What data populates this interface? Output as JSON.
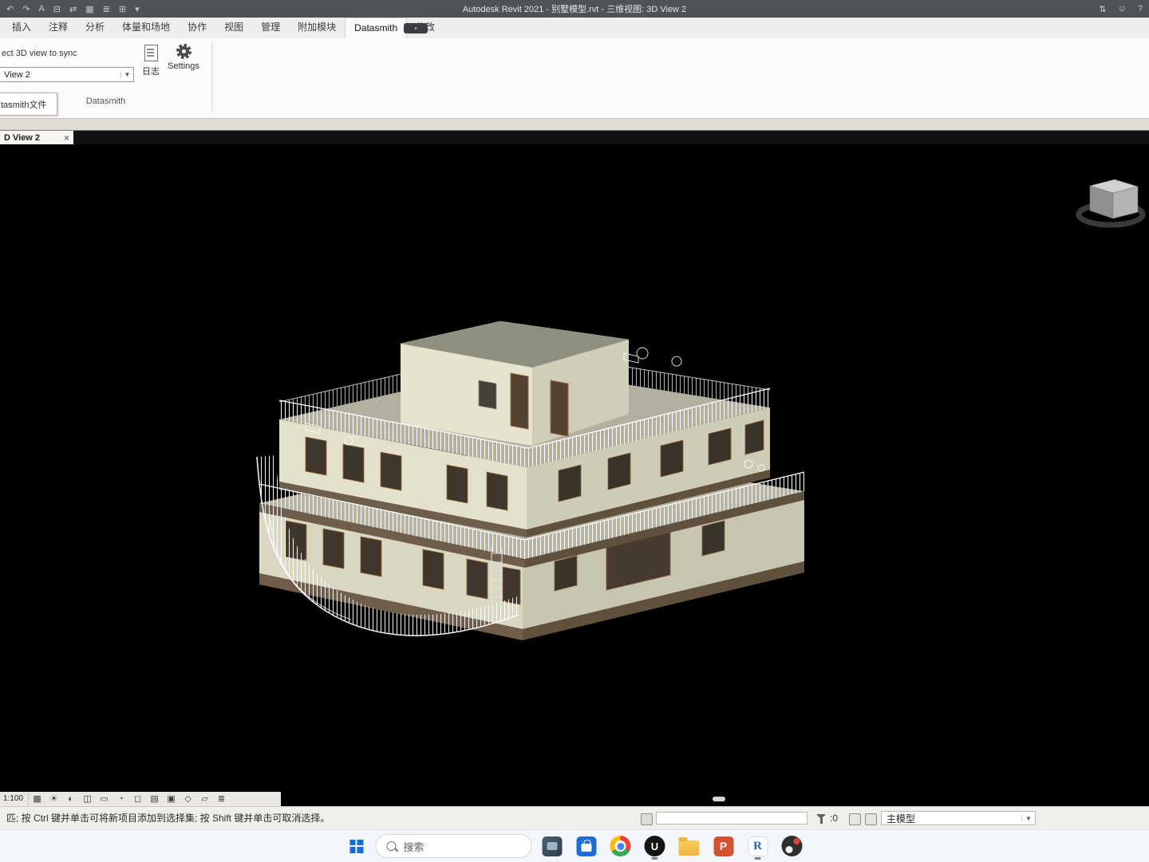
{
  "title_bar": {
    "title": "Autodesk Revit 2021 - 别墅模型.rvt - 三维视图: 3D View 2",
    "qat_icons": [
      {
        "name": "undo-icon",
        "glyph": "↶"
      },
      {
        "name": "redo-icon",
        "glyph": "↷"
      },
      {
        "name": "text-icon",
        "glyph": "A"
      },
      {
        "name": "print-icon",
        "glyph": "⊟"
      },
      {
        "name": "measure-icon",
        "glyph": "⇄"
      },
      {
        "name": "grid-icon",
        "glyph": "▦"
      },
      {
        "name": "list-icon",
        "glyph": "≣"
      },
      {
        "name": "tile-windows-icon",
        "glyph": "⊞"
      },
      {
        "name": "qat-dropdown-icon",
        "glyph": "▾"
      }
    ],
    "right_icons": [
      {
        "name": "collaborate-icon",
        "glyph": "⇅"
      },
      {
        "name": "user-icon",
        "glyph": "☺"
      },
      {
        "name": "help-icon",
        "glyph": "?"
      }
    ]
  },
  "ribbon": {
    "tabs": [
      {
        "label": "插入"
      },
      {
        "label": "注释"
      },
      {
        "label": "分析"
      },
      {
        "label": "体量和场地"
      },
      {
        "label": "协作"
      },
      {
        "label": "视图"
      },
      {
        "label": "管理"
      },
      {
        "label": "附加模块"
      },
      {
        "label": "Datasmith",
        "active": true
      },
      {
        "label": "修改"
      }
    ],
    "active_tab": "Datasmith",
    "extra_button_glyph": "▪"
  },
  "datasmith": {
    "sync_label": "ect 3D view to sync",
    "view_value": "View 2",
    "arrow_glyph": "▼",
    "log_label": "日志",
    "settings_label": "Settings",
    "panel_title": "Datasmith",
    "file_panel_label": "tasmith文件"
  },
  "view_tab": {
    "label": "D View 2",
    "close_glyph": "×"
  },
  "viewbar": {
    "scale_label": "1:100",
    "icons": [
      {
        "name": "visual-style-icon",
        "glyph": "▦"
      },
      {
        "name": "sun-path-icon",
        "glyph": "☀"
      },
      {
        "name": "shadows-icon",
        "glyph": "◐"
      },
      {
        "name": "crop-view-icon",
        "glyph": "◫"
      },
      {
        "name": "crop-region-icon",
        "glyph": "▭"
      },
      {
        "name": "temporary-hide-icon",
        "glyph": "◔"
      },
      {
        "name": "reveal-hidden-icon",
        "glyph": "◻"
      },
      {
        "name": "worksharing-display-icon",
        "glyph": "▤"
      },
      {
        "name": "temporary-view-icon",
        "glyph": "▣"
      },
      {
        "name": "analytical-model-icon",
        "glyph": "◇"
      },
      {
        "name": "constraints-icon",
        "glyph": "▱"
      },
      {
        "name": "more-tools-icon",
        "glyph": "≣"
      }
    ]
  },
  "status_bar": {
    "message": "匹; 按 Ctrl 键并单击可将新项目添加到选择集; 按 Shift 键并单击可取消选择。",
    "filter_count": ":0",
    "workset_value": "主模型",
    "arrow_glyph": "▼"
  },
  "taskbar": {
    "search_label": "搜索",
    "apps": [
      {
        "name": "photos"
      },
      {
        "name": "microsoft-store"
      },
      {
        "name": "chrome"
      },
      {
        "name": "unreal-engine",
        "letter": "U"
      },
      {
        "name": "file-explorer"
      },
      {
        "name": "powerpoint",
        "letter": "P"
      },
      {
        "name": "revit",
        "letter": "R"
      },
      {
        "name": "media-app"
      }
    ]
  },
  "colors": {
    "viewport_bg": "#000000",
    "titlebar_bg": "#4f5357",
    "wall": "#e3e0cb",
    "wall_shade": "#cecbb6",
    "penthouse_roof": "#8f8f7f",
    "slab": "#b2b09f",
    "fascia_brown": "#6f5e4b",
    "railing": "#ffffff",
    "taskbar_bg": "#f3f6fb",
    "accent_blue": "#1b6ec2"
  }
}
